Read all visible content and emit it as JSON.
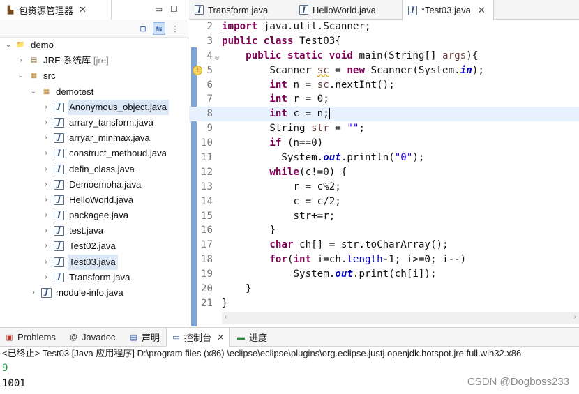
{
  "left_panel": {
    "tab_title": "包资源管理器",
    "tab_close": "✕",
    "minimize": "▭",
    "maximize": "☐"
  },
  "tree": {
    "project": "demo",
    "jre": "JRE 系统库",
    "jre_tag": "[jre]",
    "src": "src",
    "package": "demotest",
    "files": [
      "Anonymous_object.java",
      "arrary_tansform.java",
      "arryar_minmax.java",
      "construct_methoud.java",
      "defin_class.java",
      "Demoemoha.java",
      "HelloWorld.java",
      "packagee.java",
      "test.java",
      "Test02.java",
      "Test03.java",
      "Transform.java"
    ],
    "module": "module-info.java"
  },
  "editor": {
    "tabs": [
      {
        "label": "Transform.java"
      },
      {
        "label": "HelloWorld.java"
      },
      {
        "label": "*Test03.java",
        "close": "✕"
      }
    ],
    "line_numbers": [
      "2",
      "3",
      "4",
      "5",
      "6",
      "7",
      "8",
      "9",
      "10",
      "11",
      "12",
      "13",
      "14",
      "15",
      "16",
      "17",
      "18",
      "19",
      "20",
      "21"
    ],
    "code": {
      "l2a": "import",
      "l2b": " java.util.Scanner;",
      "l3a": "public class",
      "l3b": " Test03{",
      "l4a": "    public static void",
      "l4b": " main(String[] ",
      "l4c": "args",
      "l4d": "){",
      "l5a": "        Scanner ",
      "l5b": "sc",
      "l5c": " = ",
      "l5d": "new",
      "l5e": " Scanner(System.",
      "l5f": "in",
      "l5g": ");",
      "l6a": "        int",
      "l6b": " n = ",
      "l6c": "sc",
      "l6d": ".nextInt();",
      "l7a": "        int",
      "l7b": " r = 0;",
      "l8a": "        int",
      "l8b": " c = n;",
      "l9a": "        String ",
      "l9b": "str",
      "l9c": " = ",
      "l9d": "\"\"",
      "l9e": ";",
      "l10a": "        if",
      "l10b": " (n==0)",
      "l11a": "          System.",
      "l11b": "out",
      "l11c": ".println(",
      "l11d": "\"0\"",
      "l11e": ");",
      "l12a": "        while",
      "l12b": "(c!=0) {",
      "l13a": "            r = c%2;",
      "l14a": "            c = c/2;",
      "l15a": "            str+=r;",
      "l16a": "        }",
      "l17a": "        char",
      "l17b": " ch[] = str.toCharArray();",
      "l18a": "        for",
      "l18b": "(",
      "l18c": "int",
      "l18d": " i=ch.",
      "l18e": "length",
      "l18f": "-1; i>=0; i--)",
      "l19a": "            System.",
      "l19b": "out",
      "l19c": ".print(ch[i]);",
      "l20a": "    }",
      "l21a": "}"
    }
  },
  "bottom": {
    "tabs": [
      {
        "label": "Problems"
      },
      {
        "label": "Javadoc"
      },
      {
        "label": "声明"
      },
      {
        "label": "控制台",
        "close": "✕"
      },
      {
        "label": "进度"
      }
    ],
    "terminated": "<已终止> Test03 [Java 应用程序] D:\\program files  (x86) \\eclipse\\eclipse\\plugins\\org.eclipse.justj.openjdk.hotspot.jre.full.win32.x86",
    "output": [
      "9",
      "1001"
    ]
  },
  "watermark": "CSDN @Dogboss233",
  "colors": {
    "keyword": "#7f0055",
    "string": "#2a00ff",
    "field": "#0000c0",
    "input": "#1a9a4a",
    "current_line": "#e8f2fe"
  }
}
